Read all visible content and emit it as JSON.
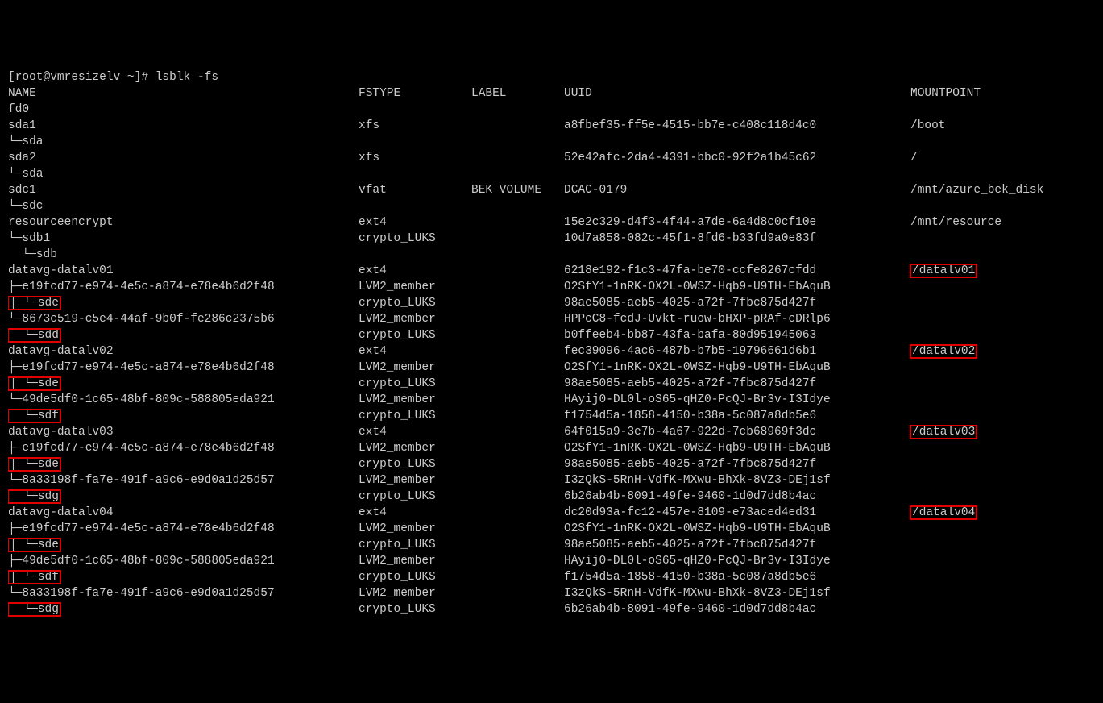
{
  "prompt": "[root@vmresizelv ~]# ",
  "command": "lsblk -fs",
  "headers": {
    "name": "NAME",
    "fstype": "FSTYPE",
    "label": "LABEL",
    "uuid": "UUID",
    "mountpoint": "MOUNTPOINT"
  },
  "rows": [
    {
      "name": "fd0",
      "fstype": "",
      "label": "",
      "uuid": "",
      "mountpoint": ""
    },
    {
      "name": "sda1",
      "fstype": "xfs",
      "label": "",
      "uuid": "a8fbef35-ff5e-4515-bb7e-c408c118d4c0",
      "mountpoint": "/boot"
    },
    {
      "name": "└─sda",
      "fstype": "",
      "label": "",
      "uuid": "",
      "mountpoint": ""
    },
    {
      "name": "sda2",
      "fstype": "xfs",
      "label": "",
      "uuid": "52e42afc-2da4-4391-bbc0-92f2a1b45c62",
      "mountpoint": "/"
    },
    {
      "name": "└─sda",
      "fstype": "",
      "label": "",
      "uuid": "",
      "mountpoint": ""
    },
    {
      "name": "sdc1",
      "fstype": "vfat",
      "label": "BEK VOLUME",
      "uuid": "DCAC-0179",
      "mountpoint": "/mnt/azure_bek_disk"
    },
    {
      "name": "└─sdc",
      "fstype": "",
      "label": "",
      "uuid": "",
      "mountpoint": ""
    },
    {
      "name": "resourceencrypt",
      "fstype": "ext4",
      "label": "",
      "uuid": "15e2c329-d4f3-4f44-a7de-6a4d8c0cf10e",
      "mountpoint": "/mnt/resource"
    },
    {
      "name": "└─sdb1",
      "fstype": "crypto_LUKS",
      "label": "",
      "uuid": "10d7a858-082c-45f1-8fd6-b33fd9a0e83f",
      "mountpoint": ""
    },
    {
      "name": "  └─sdb",
      "fstype": "",
      "label": "",
      "uuid": "",
      "mountpoint": ""
    },
    {
      "name": "datavg-datalv01",
      "fstype": "ext4",
      "label": "",
      "uuid": "6218e192-f1c3-47fa-be70-ccfe8267cfdd",
      "mountpoint": "/datalv01",
      "hlMnt": true
    },
    {
      "name": "├─e19fcd77-e974-4e5c-a874-e78e4b6d2f48",
      "fstype": "LVM2_member",
      "label": "",
      "uuid": "O2SfY1-1nRK-OX2L-0WSZ-Hqb9-U9TH-EbAquB",
      "mountpoint": ""
    },
    {
      "name": "│ └─sde",
      "fstype": "crypto_LUKS",
      "label": "",
      "uuid": "98ae5085-aeb5-4025-a72f-7fbc875d427f",
      "mountpoint": "",
      "hlName": true
    },
    {
      "name": "└─8673c519-c5e4-44af-9b0f-fe286c2375b6",
      "fstype": "LVM2_member",
      "label": "",
      "uuid": "HPPcC8-fcdJ-Uvkt-ruow-bHXP-pRAf-cDRlp6",
      "mountpoint": ""
    },
    {
      "name": "  └─sdd",
      "fstype": "crypto_LUKS",
      "label": "",
      "uuid": "b0ffeeb4-bb87-43fa-bafa-80d951945063",
      "mountpoint": "",
      "hlName": true
    },
    {
      "name": "datavg-datalv02",
      "fstype": "ext4",
      "label": "",
      "uuid": "fec39096-4ac6-487b-b7b5-19796661d6b1",
      "mountpoint": "/datalv02",
      "hlMnt": true
    },
    {
      "name": "├─e19fcd77-e974-4e5c-a874-e78e4b6d2f48",
      "fstype": "LVM2_member",
      "label": "",
      "uuid": "O2SfY1-1nRK-OX2L-0WSZ-Hqb9-U9TH-EbAquB",
      "mountpoint": ""
    },
    {
      "name": "│ └─sde",
      "fstype": "crypto_LUKS",
      "label": "",
      "uuid": "98ae5085-aeb5-4025-a72f-7fbc875d427f",
      "mountpoint": "",
      "hlName": true
    },
    {
      "name": "└─49de5df0-1c65-48bf-809c-588805eda921",
      "fstype": "LVM2_member",
      "label": "",
      "uuid": "HAyij0-DL0l-oS65-qHZ0-PcQJ-Br3v-I3Idye",
      "mountpoint": ""
    },
    {
      "name": "  └─sdf",
      "fstype": "crypto_LUKS",
      "label": "",
      "uuid": "f1754d5a-1858-4150-b38a-5c087a8db5e6",
      "mountpoint": "",
      "hlName": true
    },
    {
      "name": "datavg-datalv03",
      "fstype": "ext4",
      "label": "",
      "uuid": "64f015a9-3e7b-4a67-922d-7cb68969f3dc",
      "mountpoint": "/datalv03",
      "hlMnt": true
    },
    {
      "name": "├─e19fcd77-e974-4e5c-a874-e78e4b6d2f48",
      "fstype": "LVM2_member",
      "label": "",
      "uuid": "O2SfY1-1nRK-OX2L-0WSZ-Hqb9-U9TH-EbAquB",
      "mountpoint": ""
    },
    {
      "name": "│ └─sde",
      "fstype": "crypto_LUKS",
      "label": "",
      "uuid": "98ae5085-aeb5-4025-a72f-7fbc875d427f",
      "mountpoint": "",
      "hlName": true
    },
    {
      "name": "└─8a33198f-fa7e-491f-a9c6-e9d0a1d25d57",
      "fstype": "LVM2_member",
      "label": "",
      "uuid": "I3zQkS-5RnH-VdfK-MXwu-BhXk-8VZ3-DEj1sf",
      "mountpoint": ""
    },
    {
      "name": "  └─sdg",
      "fstype": "crypto_LUKS",
      "label": "",
      "uuid": "6b26ab4b-8091-49fe-9460-1d0d7dd8b4ac",
      "mountpoint": "",
      "hlName": true
    },
    {
      "name": "datavg-datalv04",
      "fstype": "ext4",
      "label": "",
      "uuid": "dc20d93a-fc12-457e-8109-e73aced4ed31",
      "mountpoint": "/datalv04",
      "hlMnt": true
    },
    {
      "name": "├─e19fcd77-e974-4e5c-a874-e78e4b6d2f48",
      "fstype": "LVM2_member",
      "label": "",
      "uuid": "O2SfY1-1nRK-OX2L-0WSZ-Hqb9-U9TH-EbAquB",
      "mountpoint": ""
    },
    {
      "name": "│ └─sde",
      "fstype": "crypto_LUKS",
      "label": "",
      "uuid": "98ae5085-aeb5-4025-a72f-7fbc875d427f",
      "mountpoint": "",
      "hlName": true
    },
    {
      "name": "├─49de5df0-1c65-48bf-809c-588805eda921",
      "fstype": "LVM2_member",
      "label": "",
      "uuid": "HAyij0-DL0l-oS65-qHZ0-PcQJ-Br3v-I3Idye",
      "mountpoint": ""
    },
    {
      "name": "│ └─sdf",
      "fstype": "crypto_LUKS",
      "label": "",
      "uuid": "f1754d5a-1858-4150-b38a-5c087a8db5e6",
      "mountpoint": "",
      "hlName": true
    },
    {
      "name": "└─8a33198f-fa7e-491f-a9c6-e9d0a1d25d57",
      "fstype": "LVM2_member",
      "label": "",
      "uuid": "I3zQkS-5RnH-VdfK-MXwu-BhXk-8VZ3-DEj1sf",
      "mountpoint": ""
    },
    {
      "name": "  └─sdg",
      "fstype": "crypto_LUKS",
      "label": "",
      "uuid": "6b26ab4b-8091-49fe-9460-1d0d7dd8b4ac",
      "mountpoint": "",
      "hlName": true
    }
  ]
}
